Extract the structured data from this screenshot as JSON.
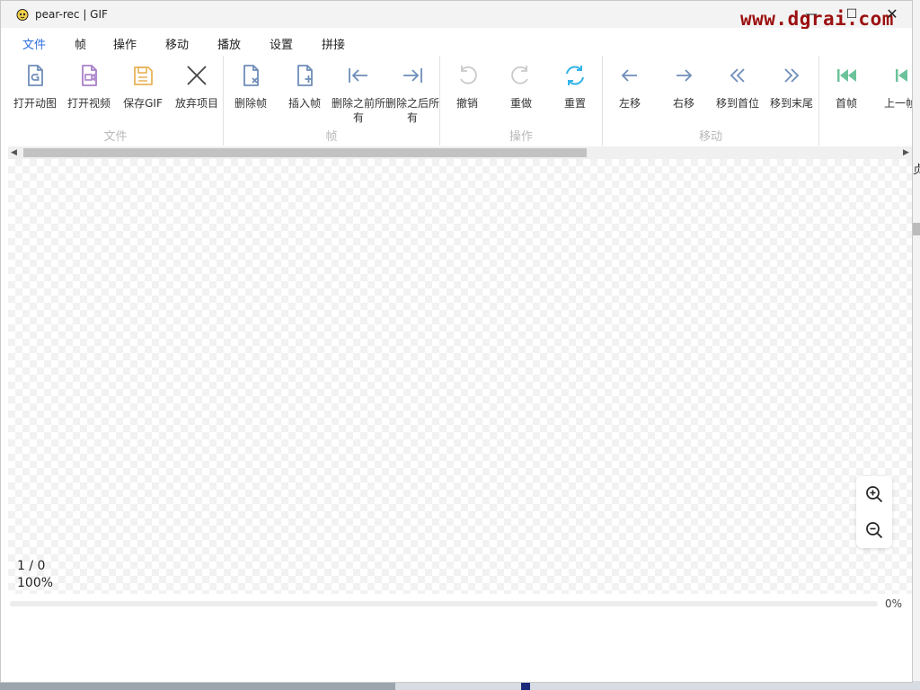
{
  "window": {
    "title": "pear-rec | GIF",
    "watermark": "www.dgrai.com",
    "controls": {
      "minimize": "—",
      "maximize": "☐",
      "close": "✕"
    }
  },
  "menu": {
    "items": [
      "文件",
      "帧",
      "操作",
      "移动",
      "播放",
      "设置",
      "拼接"
    ],
    "active": "文件"
  },
  "ribbon": {
    "groups": {
      "file": {
        "label": "文件",
        "tools": {
          "open_gif": "打开动图",
          "open_video": "打开视频",
          "save_gif": "保存GIF",
          "discard": "放弃项目"
        }
      },
      "frame": {
        "label": "帧",
        "tools": {
          "delete_frame": "删除帧",
          "insert_frame": "插入帧",
          "delete_before": "删除之前所有",
          "delete_after": "删除之后所有"
        }
      },
      "operation": {
        "label": "操作",
        "tools": {
          "undo": "撤销",
          "redo": "重做",
          "reset": "重置"
        }
      },
      "move": {
        "label": "移动",
        "tools": {
          "move_left": "左移",
          "move_right": "右移",
          "move_first": "移到首位",
          "move_last": "移到末尾"
        }
      },
      "play": {
        "tools": {
          "first_frame": "首帧",
          "prev_frame": "上一帧"
        }
      }
    }
  },
  "colors": {
    "accent": "#2d6fe0",
    "icon_gray_blue": "#6e8db8",
    "icon_purple": "#a880c8",
    "icon_orange": "#e8b25a",
    "icon_cyan": "#33b4e8",
    "icon_green": "#6cc39b",
    "watermark": "#9c1010"
  },
  "status": {
    "frame_counter": "1 / 0",
    "zoom": "100%",
    "progress_text": "0%",
    "progress_value": 0
  },
  "side_glyph": "贞"
}
